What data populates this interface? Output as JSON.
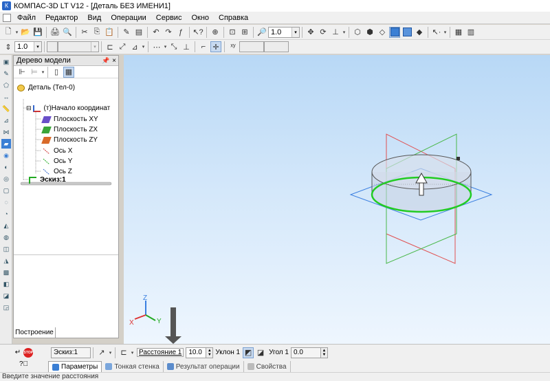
{
  "window": {
    "title": "КОМПАС-3D LT V12 - [Деталь БЕЗ ИМЕНИ1]"
  },
  "menu": [
    "Файл",
    "Редактор",
    "Вид",
    "Операции",
    "Сервис",
    "Окно",
    "Справка"
  ],
  "toolbar": {
    "zoom_value": "1.0",
    "step_value": "1.0"
  },
  "tree_panel": {
    "title": "Дерево модели",
    "items": [
      {
        "label": "Деталь (Тел-0)",
        "icon": "part-icon"
      },
      {
        "label": "(т)Начало координат",
        "icon": "origin-icon"
      },
      {
        "label": "Плоскость XY",
        "icon": "plane-xy-icon",
        "color": "#6a4fc9"
      },
      {
        "label": "Плоскость ZX",
        "icon": "plane-zx-icon",
        "color": "#3aa53a"
      },
      {
        "label": "Плоскость ZY",
        "icon": "plane-zy-icon",
        "color": "#d86a2a"
      },
      {
        "label": "Ось X",
        "icon": "axis-x-icon",
        "color": "#c33"
      },
      {
        "label": "Ось Y",
        "icon": "axis-y-icon",
        "color": "#2a2"
      },
      {
        "label": "Ось Z",
        "icon": "axis-z-icon",
        "color": "#36c"
      },
      {
        "label": "Эскиз:1",
        "icon": "sketch-icon"
      }
    ],
    "tab": "Построение"
  },
  "viewport": {
    "triad": {
      "x_label": "X",
      "y_label": "Y",
      "z_label": "Z"
    }
  },
  "properties": {
    "sketch_field": "Эскиз:1",
    "distance_label": "Расстояние 1",
    "distance_value": "10.0",
    "slope_label": "Уклон 1",
    "angle_label": "Угол 1",
    "angle_value": "0.0"
  },
  "prop_tabs": [
    "Параметры",
    "Тонкая стенка",
    "Результат операции",
    "Свойства"
  ],
  "status": {
    "text": "Введите значение расстояния"
  },
  "colors": {
    "accent": "#3b7fd4",
    "extrude_ring": "#22cc22",
    "plane_red": "#e05050",
    "plane_blue": "#3a7fe0",
    "plane_green": "#4ab84a"
  }
}
